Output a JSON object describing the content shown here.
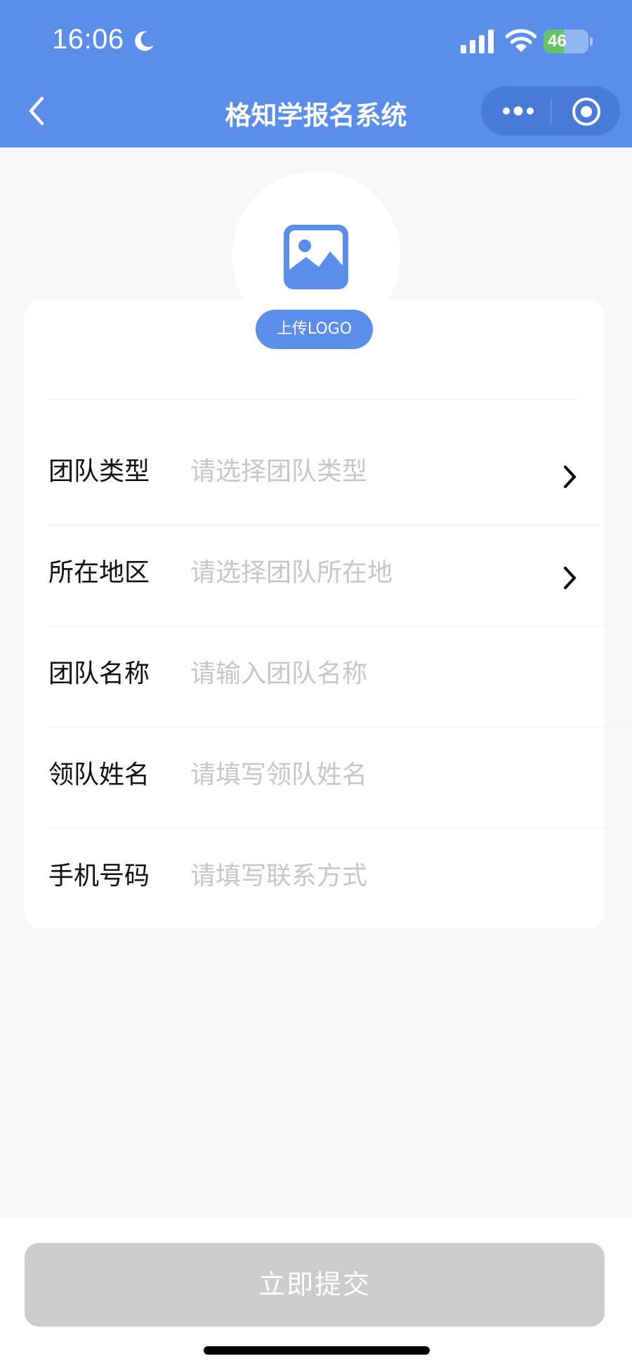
{
  "status_bar": {
    "time": "16:06",
    "battery_level": "46",
    "battery_fraction": 0.46,
    "icons": [
      "moon-icon",
      "signal-icon",
      "wifi-icon",
      "battery-icon"
    ]
  },
  "nav": {
    "title": "格知学报名系统",
    "back_icon": "chevron-left-icon",
    "more_icon": "more-dots-icon",
    "close_icon": "target-close-icon"
  },
  "logo": {
    "icon": "image-icon",
    "upload_label": "上传LOGO"
  },
  "form": {
    "rows": [
      {
        "label": "团队类型",
        "placeholder": "请选择团队类型",
        "arrow": true
      },
      {
        "label": "所在地区",
        "placeholder": "请选择团队所在地",
        "arrow": true
      },
      {
        "label": "团队名称",
        "placeholder": "请输入团队名称",
        "arrow": false
      },
      {
        "label": "领队姓名",
        "placeholder": "请填写领队姓名",
        "arrow": false
      },
      {
        "label": "手机号码",
        "placeholder": "请填写联系方式",
        "arrow": false
      }
    ]
  },
  "submit": {
    "label": "立即提交"
  },
  "colors": {
    "primary": "#5a8eea",
    "background": "#f7f7f7",
    "placeholder": "#c6c6c6",
    "disabled_button": "#cccccc"
  }
}
